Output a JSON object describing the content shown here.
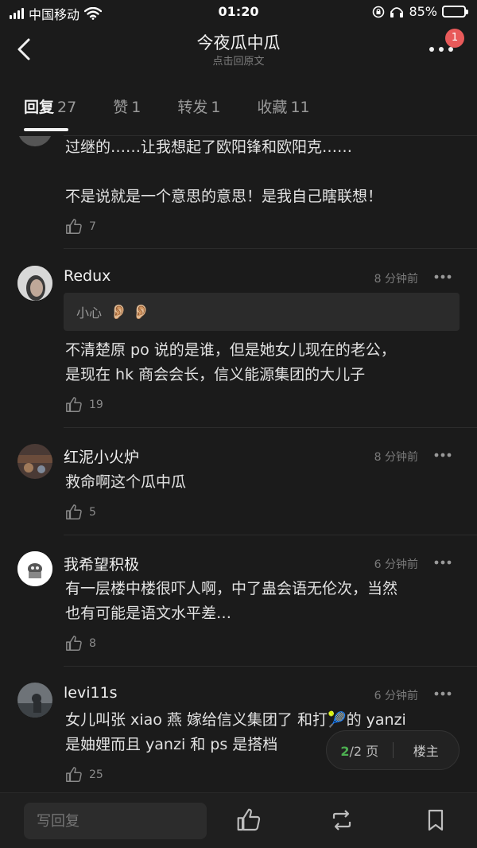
{
  "status": {
    "carrier": "中国移动",
    "time": "01:20",
    "battery": "85%",
    "battery_level": 0.85
  },
  "nav": {
    "title": "今夜瓜中瓜",
    "subtitle": "点击回原文",
    "badge": "1"
  },
  "tabs": [
    {
      "label": "回复",
      "count": "27"
    },
    {
      "label": "赞",
      "count": "1"
    },
    {
      "label": "转发",
      "count": "1"
    },
    {
      "label": "收藏",
      "count": "11"
    }
  ],
  "comments": [
    {
      "text_lines": [
        "过继的……让我想起了欧阳锋和欧阳克……",
        "",
        "不是说就是一个意思的意思！是我自己瞎联想！"
      ],
      "likes": "7"
    },
    {
      "name": "Redux",
      "time": "8 分钟前",
      "quote": "小心",
      "quote_emoji": "👂🏼 👂🏼",
      "text_lines": [
        "不清楚原 po 说的是谁，但是她女儿现在的老公，",
        "是现在 hk 商会会长，信义能源集团的大儿子"
      ],
      "likes": "19"
    },
    {
      "name": "红泥小火炉",
      "time": "8 分钟前",
      "text_lines": [
        "救命啊这个瓜中瓜"
      ],
      "likes": "5"
    },
    {
      "name": "我希望积极",
      "time": "6 分钟前",
      "text_lines": [
        "有一层楼中楼很吓人啊，中了蛊会语无伦次，当然",
        "也有可能是语文水平差…"
      ],
      "likes": "8"
    },
    {
      "name": "levi11s",
      "time": "6 分钟前",
      "text_lines": [
        "女儿叫张 xiao 燕  嫁给信义集团了  和打🎾的 yanzi",
        "是妯娌而且 yanzi 和 ps 是搭档"
      ],
      "likes": "25"
    }
  ],
  "pager": {
    "current": "2",
    "total_label": "/2 页",
    "owner_label": "楼主"
  },
  "bottom": {
    "reply_placeholder": "写回复"
  },
  "colors": {
    "background": "#1b1b1b",
    "badge": "#e85a5a",
    "pager_current": "#4caf50"
  }
}
